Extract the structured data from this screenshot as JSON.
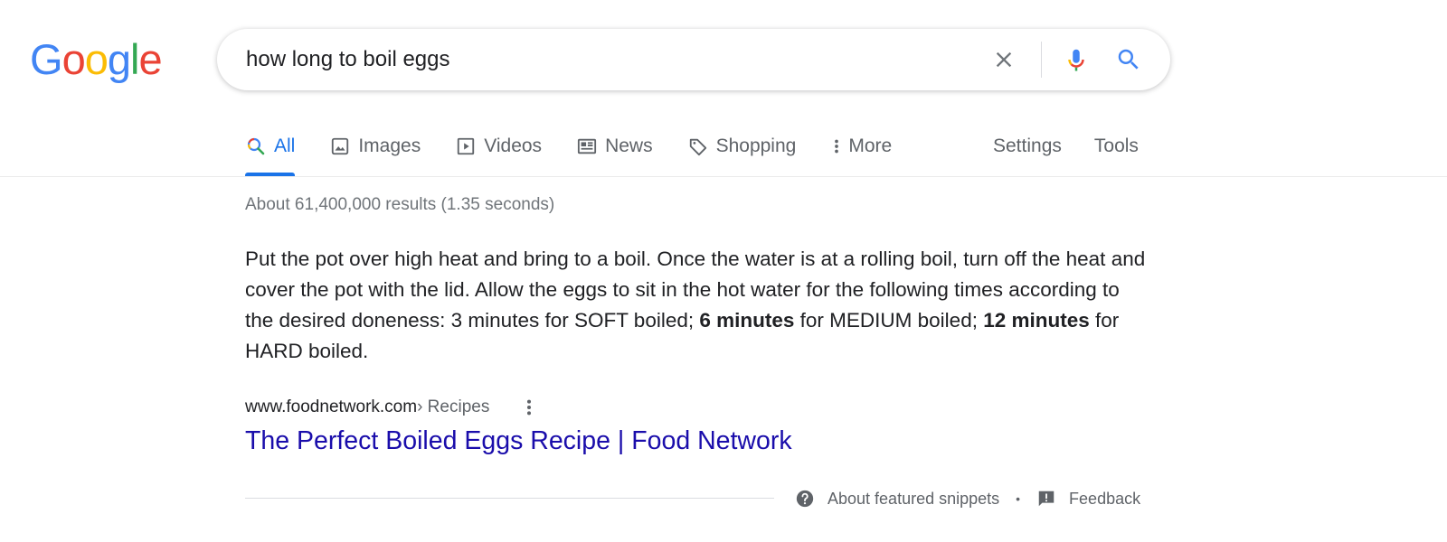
{
  "logo": {
    "text": "Google",
    "letters": [
      {
        "ch": "G",
        "color": "#4285F4"
      },
      {
        "ch": "o",
        "color": "#EA4335"
      },
      {
        "ch": "o",
        "color": "#FBBC05"
      },
      {
        "ch": "g",
        "color": "#4285F4"
      },
      {
        "ch": "l",
        "color": "#34A853"
      },
      {
        "ch": "e",
        "color": "#EA4335"
      }
    ]
  },
  "search": {
    "value": "how long to boil eggs",
    "clear_icon": "close-icon",
    "mic_icon": "microphone-icon",
    "search_icon": "search-icon"
  },
  "tabs": {
    "items": [
      {
        "label": "All",
        "icon": "search-icon",
        "active": true
      },
      {
        "label": "Images",
        "icon": "image-icon"
      },
      {
        "label": "Videos",
        "icon": "play-icon"
      },
      {
        "label": "News",
        "icon": "newspaper-icon"
      },
      {
        "label": "Shopping",
        "icon": "tag-icon"
      },
      {
        "label": "More",
        "icon": "more-vert-icon"
      }
    ],
    "settings_label": "Settings",
    "tools_label": "Tools"
  },
  "results": {
    "stats": "About 61,400,000 results (1.35 seconds)",
    "snippet": {
      "part1": "Put the pot over high heat and bring to a boil. Once the water is at a rolling boil, turn off the heat and cover the pot with the lid. Allow the eggs to sit in the hot water for the following times according to the desired doneness: 3 minutes for SOFT boiled; ",
      "bold1": "6 minutes",
      "part2": " for MEDIUM boiled; ",
      "bold2": "12 minutes",
      "part3": " for HARD boiled."
    },
    "cite_domain": "www.foodnetwork.com",
    "cite_path": " › Recipes",
    "title": "The Perfect Boiled Eggs Recipe | Food Network"
  },
  "footer": {
    "about_label": "About featured snippets",
    "separator": "•",
    "feedback_label": "Feedback"
  },
  "colors": {
    "accent": "#1a73e8",
    "link": "#1a0dab",
    "muted": "#5f6368"
  }
}
